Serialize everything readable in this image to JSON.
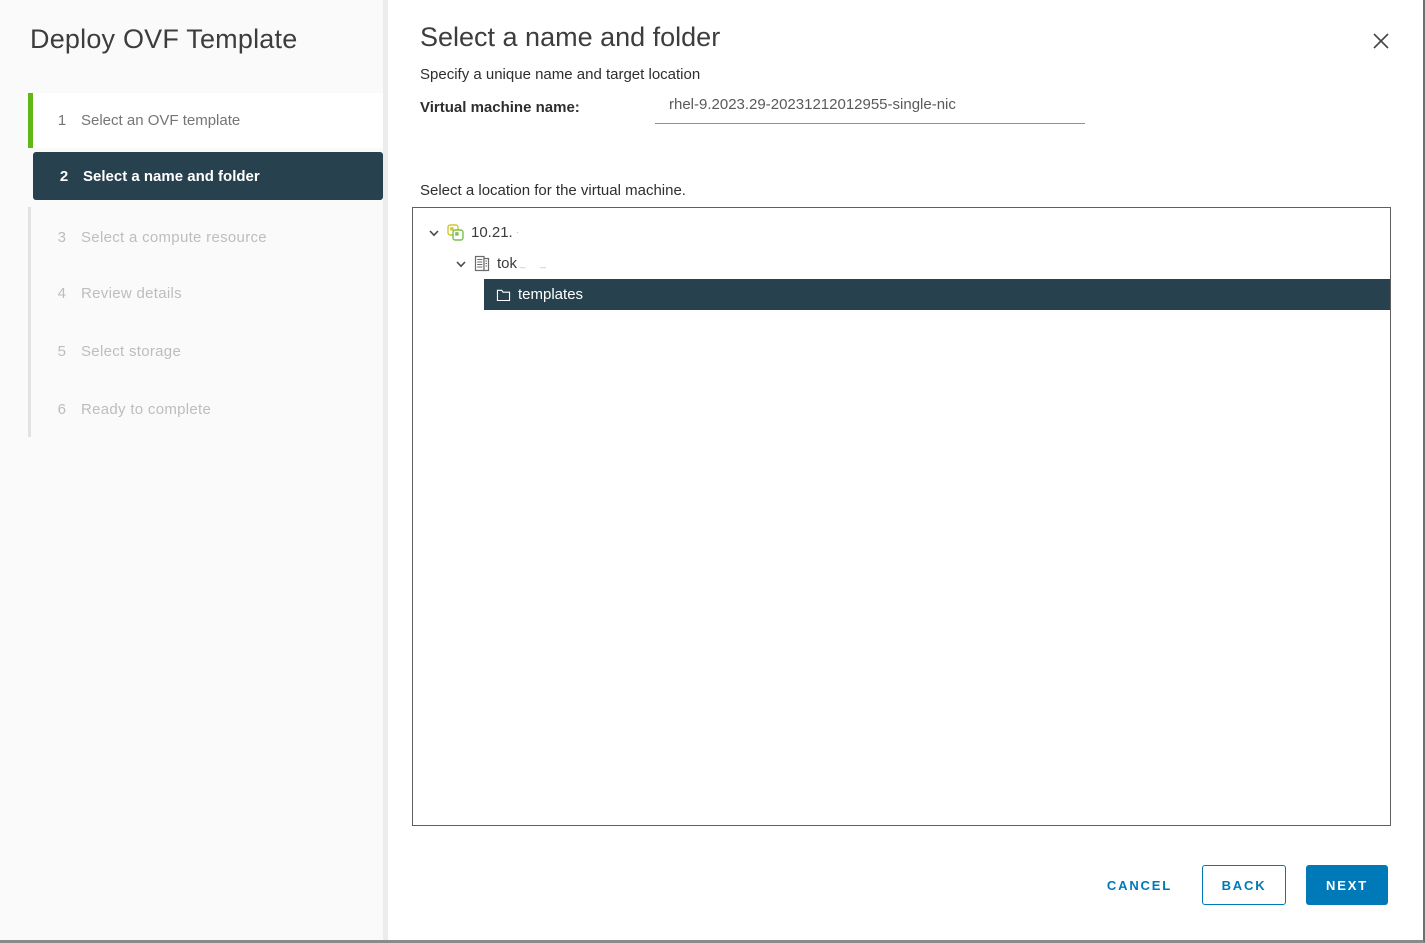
{
  "window": {
    "close_icon": "close-x"
  },
  "sidebar": {
    "title": "Deploy OVF Template",
    "steps": [
      {
        "num": "1",
        "label": "Select an OVF template",
        "state": "completed"
      },
      {
        "num": "2",
        "label": "Select a name and folder",
        "state": "current"
      },
      {
        "num": "3",
        "label": "Select a compute resource",
        "state": "upcoming"
      },
      {
        "num": "4",
        "label": "Review details",
        "state": "upcoming"
      },
      {
        "num": "5",
        "label": "Select storage",
        "state": "upcoming"
      },
      {
        "num": "6",
        "label": "Ready to complete",
        "state": "upcoming"
      }
    ]
  },
  "main": {
    "title": "Select a name and folder",
    "subtitle": "Specify a unique name and target location",
    "vm_name_label": "Virtual machine name:",
    "vm_name_value": "rhel-9.2023.29-20231212012955-single-nic",
    "location_label": "Select a location for the virtual machine.",
    "tree": [
      {
        "label": "10.21.",
        "redacted_suffix": "·",
        "icon": "vcenter-icon",
        "level": 0,
        "expanded": true,
        "selected": false
      },
      {
        "label": "tok",
        "redacted_suffix": "_   _",
        "icon": "datacenter-icon",
        "level": 1,
        "expanded": true,
        "selected": false
      },
      {
        "label": "templates",
        "icon": "folder-icon",
        "level": 2,
        "expanded": false,
        "selected": true
      }
    ]
  },
  "footer": {
    "cancel_label": "CANCEL",
    "back_label": "BACK",
    "next_label": "NEXT"
  },
  "colors": {
    "accent_green": "#61b715",
    "primary_blue": "#0079b8",
    "selected_row_bg": "#28414e"
  }
}
